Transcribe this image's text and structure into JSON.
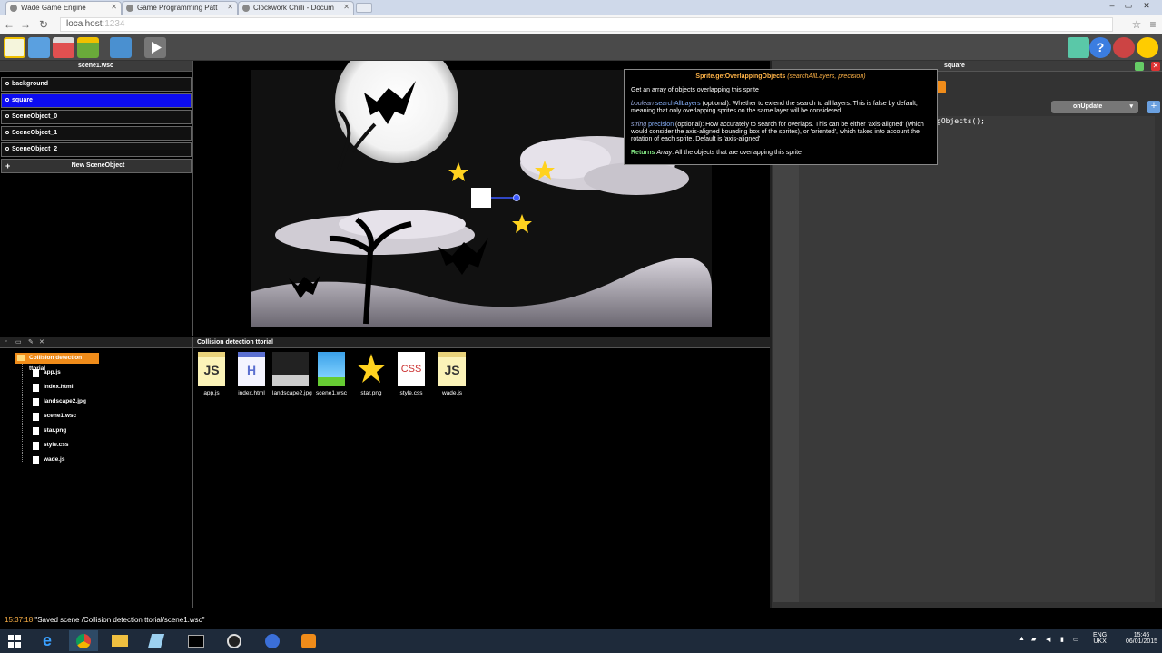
{
  "browser": {
    "tabs": [
      {
        "title": "Wade Game Engine",
        "active": true
      },
      {
        "title": "Game Programming Patt",
        "active": false
      },
      {
        "title": "Clockwork Chilli - Docum",
        "active": false
      }
    ],
    "url_host": "localhost",
    "url_port": ":1234"
  },
  "scene_panel": {
    "title": "scene1.wsc",
    "objects": [
      {
        "label": "background",
        "selected": false
      },
      {
        "label": "square",
        "selected": true
      },
      {
        "label": "SceneObject_0",
        "selected": false
      },
      {
        "label": "SceneObject_1",
        "selected": false
      },
      {
        "label": "SceneObject_2",
        "selected": false
      }
    ],
    "new_button": "New SceneObject"
  },
  "tooltip": {
    "title_fn": "Sprite.getOverlappingObjects",
    "title_args": "(searchAllLayers, precision)",
    "summary": "Get an array of objects overlapping this sprite",
    "p1_type": "boolean",
    "p1_name": "searchAllLayers",
    "p1_desc": "(optional): Whether to extend the search to all layers. This is false by default, meaning that only overlapping sprites on the same layer will be considered.",
    "p2_type": "string",
    "p2_name": "precision",
    "p2_desc": "(optional): How accurately to search for overlaps. This can be either 'axis-aligned' (which would consider the axis-aligned bounding box of the sprites), or 'oriented', which takes into account the rotation of each sprite. Default is 'axis-aligned'",
    "returns_label": "Returns",
    "returns_type": "Array",
    "returns_desc": ": All the objects that are overlapping this sprite"
  },
  "right_panel": {
    "title": "square",
    "event_select": "onUpdate",
    "code_line": "gObjects();"
  },
  "file_browser": {
    "folder_name": "Collision detection ttorial",
    "header": "Collision detection ttorial",
    "tree": [
      "app.js",
      "index.html",
      "landscape2.jpg",
      "scene1.wsc",
      "star.png",
      "style.css",
      "wade.js"
    ],
    "grid": [
      {
        "label": "app.js",
        "icon": "js-file-icon",
        "badge": "JS"
      },
      {
        "label": "index.html",
        "icon": "html-file-icon",
        "badge": "H"
      },
      {
        "label": "landscape2.jpg",
        "icon": "image-thumbnail-icon",
        "badge": ""
      },
      {
        "label": "scene1.wsc",
        "icon": "scene-file-icon",
        "badge": ""
      },
      {
        "label": "star.png",
        "icon": "star-icon",
        "badge": ""
      },
      {
        "label": "style.css",
        "icon": "css-file-icon",
        "badge": "CSS"
      },
      {
        "label": "wade.js",
        "icon": "js-file-icon",
        "badge": "JS"
      }
    ]
  },
  "status": {
    "time": "15:37:18",
    "message": "\"Saved scene /Collision detection ttorial/scene1.wsc\""
  },
  "taskbar": {
    "lang1": "ENG",
    "lang2": "UKX",
    "clock_time": "15:46",
    "clock_date": "06/01/2015"
  },
  "colors": {
    "accent_orange": "#f08c1a",
    "selection_blue": "#0c0cf0",
    "tooltip_title": "#ffb347"
  }
}
